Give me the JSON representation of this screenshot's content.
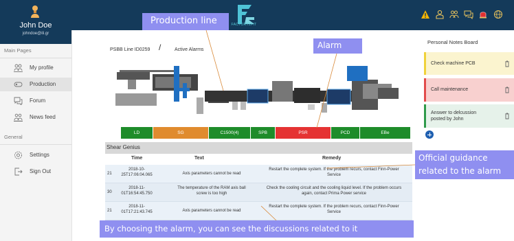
{
  "user": {
    "name": "John Doe",
    "email": "johndoe@ili.gr"
  },
  "sidebar": {
    "main_section": "Main Pages",
    "general_section": "General",
    "items": [
      {
        "label": "My profile",
        "icon": "users-icon"
      },
      {
        "label": "Production",
        "icon": "production-icon",
        "active": true
      },
      {
        "label": "Forum",
        "icon": "chat-bubbles-icon"
      },
      {
        "label": "News feed",
        "icon": "news-feed-icon"
      },
      {
        "label": "Settings",
        "icon": "gear-icon"
      },
      {
        "label": "Sign Out",
        "icon": "sign-out-icon"
      }
    ]
  },
  "topbar": {
    "logo_text": "FACTORY2FIT",
    "icons": [
      "warning-icon",
      "worker-icon",
      "group-icon",
      "messages-icon",
      "alarm-bell-icon",
      "globe-icon"
    ],
    "colors": {
      "bar": "#143a5a",
      "warning": "#f5b400",
      "alarm": "#e03030"
    }
  },
  "breadcrumb": {
    "line": "PSBB Line ID0259",
    "separator": "/",
    "page": "Active Alarms"
  },
  "stations": [
    {
      "label": "LD",
      "color": "#1e8c2a"
    },
    {
      "label": "SG",
      "color": "#e08b2e"
    },
    {
      "label": "C1500(4)",
      "color": "#1e8c2a"
    },
    {
      "label": "SPB",
      "color": "#1e8c2a"
    },
    {
      "label": "PSR",
      "color": "#e53333"
    },
    {
      "label": "PCD",
      "color": "#1e8c2a"
    },
    {
      "label": "EBe",
      "color": "#1e8c2a"
    }
  ],
  "machine": "Shear Genius",
  "table": {
    "headers": [
      "Time",
      "Text",
      "Remedy"
    ],
    "rows": [
      {
        "id": "21",
        "time1": "2018-10-",
        "time2": "25T17:06:04.065",
        "text1": "Axis parameters cannot be read",
        "text2": "",
        "rem1": "Restart the complete system. If the problem recurs, contact Finn-Power",
        "rem2": "Service"
      },
      {
        "id": "30",
        "time1": "2018-11-",
        "time2": "01T16:54:45.750",
        "text1": "The temperature of the RAM axis ball",
        "text2": "screw is too high",
        "rem1": "Check the cooling circuit and the cooling liquid level. If the problem occurs",
        "rem2": "again, contact Prima Power service"
      },
      {
        "id": "21",
        "time1": "2018-11-",
        "time2": "01T17:21:43.745",
        "text1": "Axis parameters cannot be read",
        "text2": "",
        "rem1": "Restart the complete system. If the problem recurs, contact Finn-Power",
        "rem2": "Service"
      }
    ]
  },
  "notes": {
    "title": "Personal Notes Board",
    "items": [
      {
        "line1": "Check machine PCB",
        "line2": "",
        "bg": "#fbf4cf",
        "border": "#f0d23a"
      },
      {
        "line1": "Call maintenance",
        "line2": "",
        "bg": "#f8d0cf",
        "border": "#e24b4b"
      },
      {
        "line1": "Answer to delcussion",
        "line2": "posted by John",
        "bg": "#e6f2ea",
        "border": "#2e9a4a"
      }
    ]
  },
  "annotations": {
    "production_line": "Production line",
    "alarm": "Alarm",
    "guidance_1": "Official guidance",
    "guidance_2": "related to the alarm",
    "bottom": "By choosing the alarm, you can see the discussions related to it",
    "color": "#8f8ff0"
  }
}
